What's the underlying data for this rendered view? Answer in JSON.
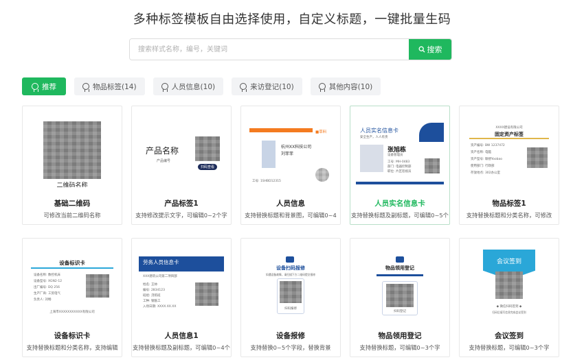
{
  "headline": "多种标签模板自由选择使用，自定义标题，一键批量生码",
  "search": {
    "placeholder": "搜索样式名称，编号，关键词",
    "button_label": "搜索"
  },
  "tabs": [
    {
      "label": "推荐",
      "active": true
    },
    {
      "label": "物品标签(14)",
      "active": false
    },
    {
      "label": "人员信息(10)",
      "active": false
    },
    {
      "label": "来访登记(10)",
      "active": false
    },
    {
      "label": "其他内容(10)",
      "active": false
    }
  ],
  "colors": {
    "accent": "#1fb85e",
    "orange": "#f47b20",
    "blue": "#1d4f9c",
    "teal": "#2aa7d8"
  },
  "cards": [
    {
      "title": "基础二维码",
      "desc": "可修改当前二维码名称",
      "thumb": {
        "caption": "二维码名称"
      }
    },
    {
      "title": "产品标签1",
      "desc": "支持修改提示文字，可编辑0~2个字",
      "thumb": {
        "name": "产品名称",
        "code": "产品编号",
        "badge": "扫码查看"
      }
    },
    {
      "title": "人员信息",
      "desc": "支持替换标题和背景图，可编辑0~4",
      "thumb": {
        "company": "杭州XX科技公司",
        "person": "刘菲菲",
        "brand": "■草料",
        "footer": "工号: 1SHBD12315"
      }
    },
    {
      "title": "人员实名信息卡",
      "desc": "支持替换标题及副标题，可编辑0~5个",
      "selected": true,
      "thumb": {
        "header": "人员实名信息卡",
        "sub": "安全生产，人人有责",
        "name": "张旭栋",
        "role": "设备管理员",
        "lines": [
          "工号: MH-0483",
          "部门: 电器控制部",
          "职位: 片区巡视员"
        ]
      }
    },
    {
      "title": "物品标签1",
      "desc": "支持替换标题和分类名称，可修改",
      "thumb": {
        "company": "XXXX建设有限公司",
        "header": "固定资产标签",
        "lines": [
          "资产编号: BW 1237472",
          "资产名称: 电脑",
          "资产型号: 联想Yoobao",
          "使用部门: 行政部",
          "存放地点: 302办公室"
        ]
      }
    },
    {
      "title": "设备标识卡",
      "desc": "支持替换标题和分类名称，支持编辑",
      "thumb": {
        "header": "设备标识卡",
        "lines": [
          "设备名称: 数控机床",
          "设备型号: XGN2-12",
          "出厂编号: DQ 256",
          "生产厂商: 工贸电气",
          "负责人: 刘畅"
        ],
        "footer": "上海市XXXXXXXXXXX有限公司"
      }
    },
    {
      "title": "人员信息1",
      "desc": "支持替换标题及副标题，可编辑0~4个",
      "thumb": {
        "header": "劳务人员信息卡",
        "sub": "XXX建筑公司第二项目部",
        "lines": [
          "姓名: 王帅",
          "编号: 2834123",
          "班组: 浇筑班",
          "工种: 钢筋工",
          "入场日期: XXXX.XX.XX"
        ]
      }
    },
    {
      "title": "设备报修",
      "desc": "支持替换0~5个字段，替换背景",
      "thumb": {
        "header": "设备扫码报修",
        "note": "如遇设备故障，请扫描下方二维码提交报修",
        "footer": "扫码报修"
      }
    },
    {
      "title": "物品领用登记",
      "desc": "支持替换标题，可编辑0~3个字",
      "thumb": {
        "header": "物品领用登记",
        "footer": "扫码登记"
      }
    },
    {
      "title": "会议签到",
      "desc": "支持替换标题，可编辑0~3个字",
      "thumb": {
        "header": "会议签到",
        "caption": "◆ 微信扫码签到 ◆",
        "note": "扫码后填写信息完成会议签到"
      }
    }
  ]
}
